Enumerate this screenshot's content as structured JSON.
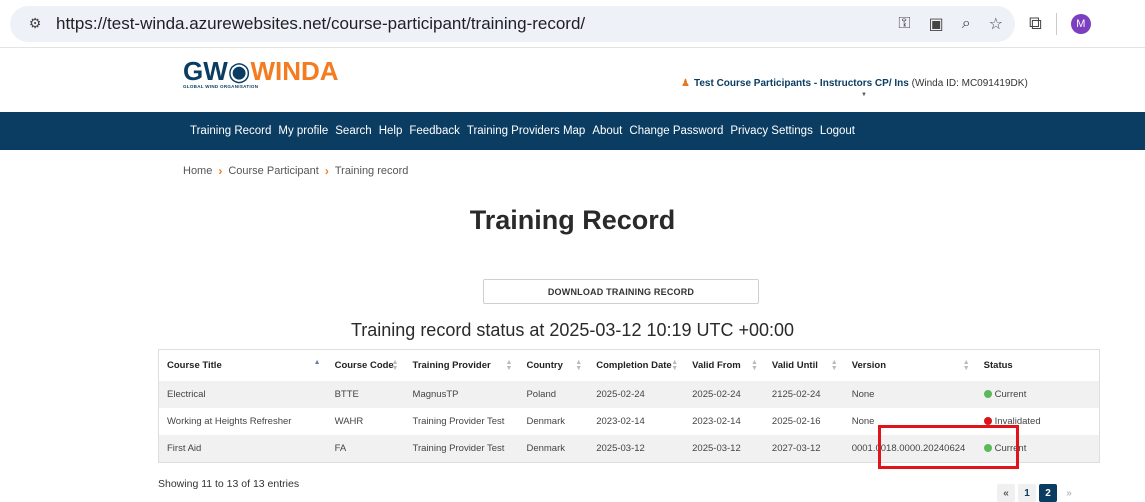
{
  "browser": {
    "url": "https://test-winda.azurewebsites.net/course-participant/training-record/",
    "avatar_letter": "M"
  },
  "header": {
    "logo_gw": "GW",
    "logo_winda": "WINDA",
    "logo_sub": "GLOBAL WIND ORGANISATION",
    "user_name": "Test Course Participants - Instructors CP/ Ins",
    "user_id": " (Winda ID: MC091419DK)"
  },
  "nav": [
    "Training Record",
    "My profile",
    "Search",
    "Help",
    "Feedback",
    "Training Providers Map",
    "About",
    "Change Password",
    "Privacy Settings",
    "Logout"
  ],
  "breadcrumb": [
    "Home",
    "Course Participant",
    "Training record"
  ],
  "page": {
    "title": "Training Record",
    "download_label": "DOWNLOAD TRAINING RECORD",
    "status_heading": "Training record status at 2025-03-12 10:19 UTC +00:00"
  },
  "table": {
    "columns": [
      "Course Title",
      "Course Code",
      "Training Provider",
      "Country",
      "Completion Date",
      "Valid From",
      "Valid Until",
      "Version",
      "Status"
    ],
    "rows": [
      {
        "title": "Electrical",
        "code": "BTTE",
        "provider": "MagnusTP",
        "country": "Poland",
        "completion": "2025-02-24",
        "from": "2025-02-24",
        "until": "2125-02-24",
        "version": "None",
        "status": "Current",
        "status_color": "#5cb85c"
      },
      {
        "title": "Working at Heights Refresher",
        "code": "WAHR",
        "provider": "Training Provider Test",
        "country": "Denmark",
        "completion": "2023-02-14",
        "from": "2023-02-14",
        "until": "2025-02-16",
        "version": "None",
        "status": "Invalidated",
        "status_color": "#d9141b"
      },
      {
        "title": "First Aid",
        "code": "FA",
        "provider": "Training Provider Test",
        "country": "Denmark",
        "completion": "2025-03-12",
        "from": "2025-03-12",
        "until": "2027-03-12",
        "version": "0001.0018.0000.20240624",
        "status": "Current",
        "status_color": "#5cb85c"
      }
    ]
  },
  "footer": {
    "entries": "Showing 11 to 13 of 13 entries",
    "pager_first": "«",
    "pager_pages": [
      "1",
      "2"
    ],
    "pager_next": "»"
  }
}
